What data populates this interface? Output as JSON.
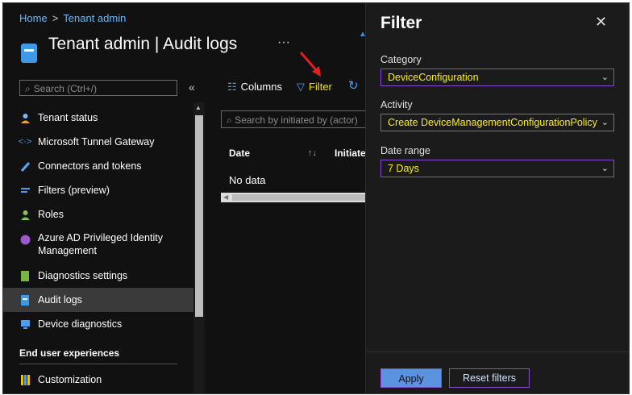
{
  "breadcrumb": {
    "home": "Home",
    "separator": ">",
    "current": "Tenant admin"
  },
  "header": {
    "title": "Tenant admin | Audit logs",
    "more": "···"
  },
  "sidebar": {
    "search_placeholder": "Search (Ctrl+/)",
    "collapse": "«",
    "items": [
      {
        "label": "Tenant status",
        "icon": "person-icon"
      },
      {
        "label": "Microsoft Tunnel Gateway",
        "icon": "tunnel-icon"
      },
      {
        "label": "Connectors and tokens",
        "icon": "connector-icon"
      },
      {
        "label": "Filters (preview)",
        "icon": "filter-list-icon"
      },
      {
        "label": "Roles",
        "icon": "roles-icon"
      },
      {
        "label": "Azure AD Privileged Identity",
        "label2": "Management",
        "icon": "pim-icon"
      },
      {
        "label": "Diagnostics settings",
        "icon": "diagnostics-icon"
      },
      {
        "label": "Audit logs",
        "icon": "audit-icon",
        "active": true
      },
      {
        "label": "Device diagnostics",
        "icon": "device-diagnostics-icon"
      }
    ],
    "section_title": "End user experiences",
    "section_items": [
      {
        "label": "Customization",
        "icon": "customization-icon"
      }
    ]
  },
  "toolbar": {
    "columns": "Columns",
    "filter": "Filter"
  },
  "content": {
    "search_placeholder": "Search by initiated by (actor)",
    "columns": [
      "Date",
      "Initiate"
    ],
    "empty": "No data"
  },
  "filter_panel": {
    "title": "Filter",
    "close": "✕",
    "category_label": "Category",
    "category_value": "DeviceConfiguration",
    "activity_label": "Activity",
    "activity_value": "Create DeviceManagementConfigurationPolicy",
    "date_label": "Date range",
    "date_value": "7 Days",
    "apply": "Apply",
    "reset": "Reset filters"
  },
  "colors": {
    "accent": "#4aa0f0",
    "highlight": "#ffee00",
    "focus": "#8a4fd1"
  }
}
